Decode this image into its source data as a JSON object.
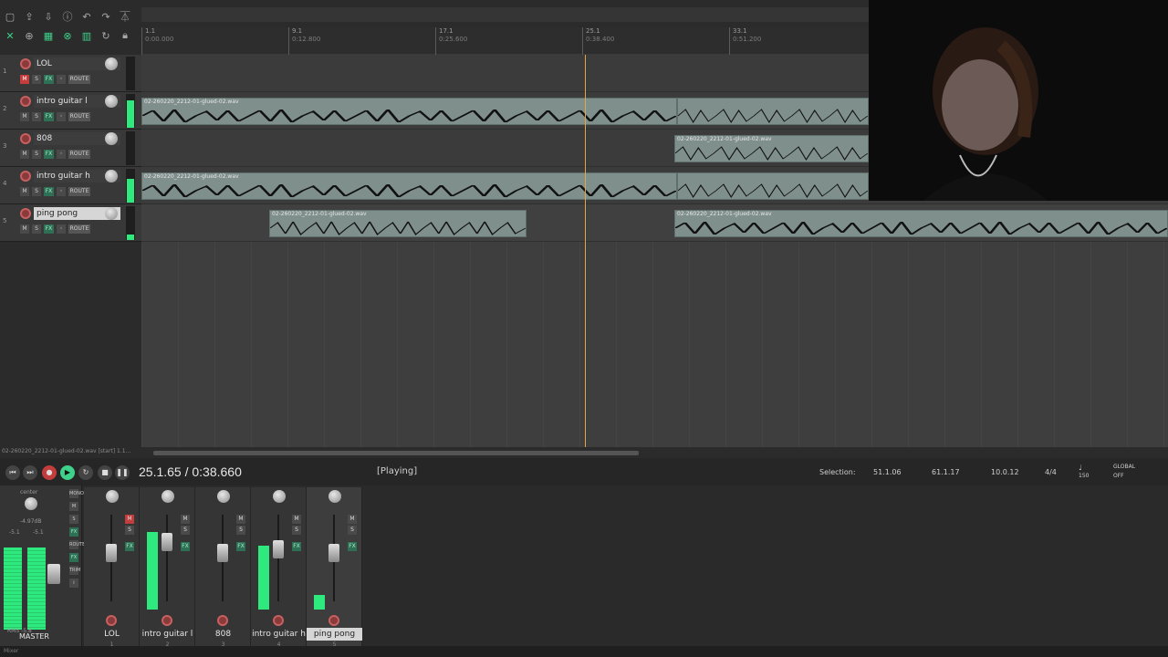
{
  "toolbar": {
    "icons": [
      "new-file-icon",
      "save-icon",
      "download-icon",
      "info-icon",
      "undo-icon",
      "redo-icon",
      "metronome-icon"
    ],
    "row2": [
      "ripple-icon",
      "link-icon",
      "grid-icon",
      "snap-icon",
      "grid2-icon",
      "loop-icon",
      "lock-icon"
    ]
  },
  "ruler": {
    "marks": [
      {
        "bar": "1.1",
        "time": "0:00.000"
      },
      {
        "bar": "9.1",
        "time": "0:12.800"
      },
      {
        "bar": "17.1",
        "time": "0:25.600"
      },
      {
        "bar": "25.1",
        "time": "0:38.400"
      },
      {
        "bar": "33.1",
        "time": "0:51.200"
      }
    ]
  },
  "tracks": [
    {
      "num": "1",
      "name": "LOL",
      "selected": false
    },
    {
      "num": "2",
      "name": "intro guitar l",
      "selected": false
    },
    {
      "num": "3",
      "name": "808",
      "selected": false
    },
    {
      "num": "4",
      "name": "intro guitar h",
      "selected": false
    },
    {
      "num": "5",
      "name": "ping pong",
      "selected": true
    }
  ],
  "track_buttons": {
    "m": "M",
    "s": "S",
    "fx": "FX",
    "route": "ROUTE"
  },
  "items": {
    "guitar_l_label": "02-260220_2212-01-glued-02.wav",
    "guitar_808_label": "02-260220_2212-01-glued-02.wav",
    "guitar_h_label": "02-260220_2212-01-glued-02.wav",
    "pingpong_label1": "02-260220_2212-01-glued-02.wav",
    "pingpong_label2": "02-260220_2212-01-glued-02.wav",
    "short_label": "02-260220..."
  },
  "status_bar": {
    "hint": "02-260220_2212-01-glued-02.wav [start] 1.1..."
  },
  "transport": {
    "time": "25.1.65 / 0:38.660",
    "state": "[Playing]",
    "selection_label": "Selection:",
    "sel_start": "51.1.06",
    "sel_end": "61.1.17",
    "sel_len": "10.0.12",
    "time_sig": "4/4",
    "bpm": "150",
    "global_label": "GLOBAL",
    "global_state": "OFF"
  },
  "mixer": {
    "master": {
      "center": "center",
      "db": "-4.97dB",
      "peakL": "-5.1",
      "peakR": "-5.1",
      "rms": "RMS",
      "rms_val": "-5.8",
      "label": "MASTER"
    },
    "master_side": [
      "MONO",
      "M",
      "S",
      "FX",
      "ROUTE",
      "FX",
      "TRIM",
      "i"
    ],
    "strips": [
      {
        "name": "LOL",
        "idx": "1",
        "selected": false,
        "level": 0
      },
      {
        "name": "intro guitar l",
        "idx": "2",
        "selected": false,
        "level": 0.85
      },
      {
        "name": "808",
        "idx": "3",
        "selected": false,
        "level": 0
      },
      {
        "name": "intro guitar h",
        "idx": "4",
        "selected": false,
        "level": 0.75
      },
      {
        "name": "ping pong",
        "idx": "5",
        "selected": true,
        "level": 0.2
      }
    ]
  },
  "bottom": {
    "tab": "Mixer"
  },
  "colors": {
    "accent": "#3fd08a",
    "record": "#c33d3d",
    "playhead": "#e3a44a",
    "meter": "#2eea7e"
  }
}
